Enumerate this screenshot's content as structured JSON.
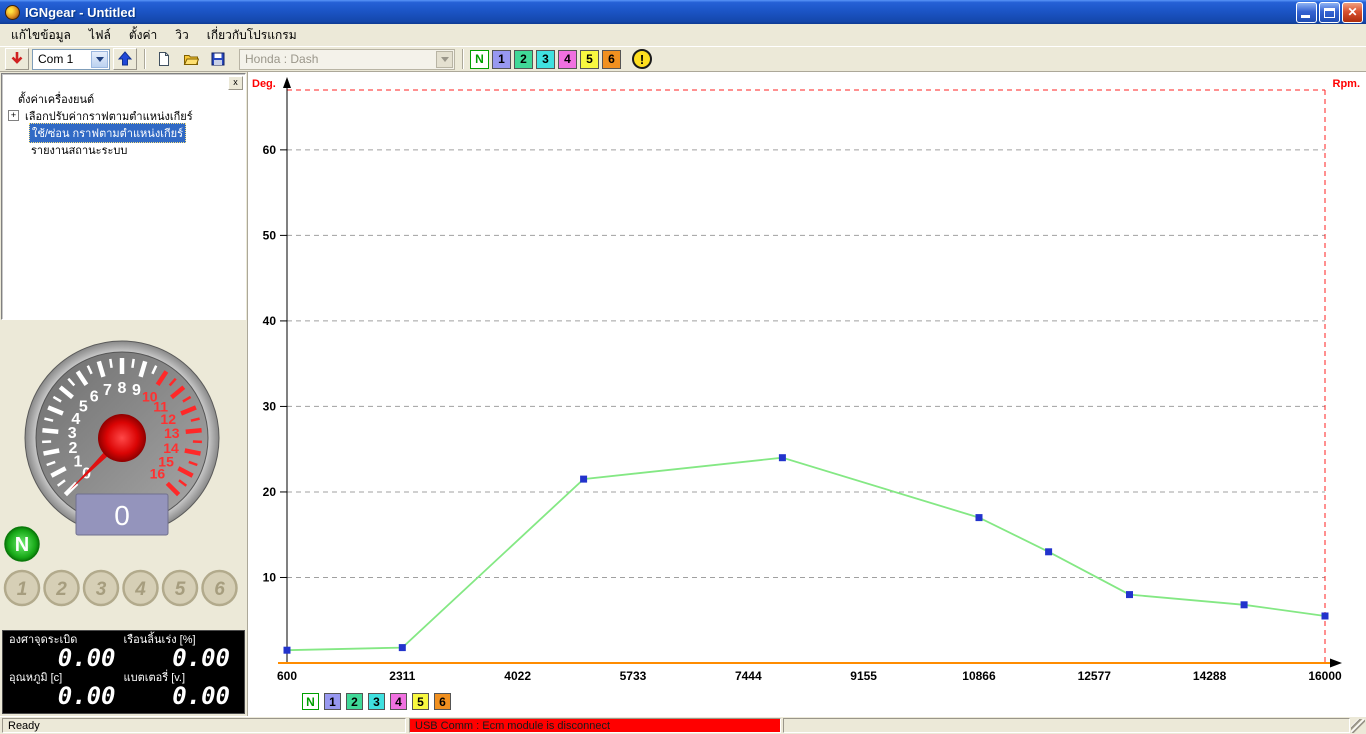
{
  "window": {
    "title": "IGNgear - Untitled"
  },
  "menu": {
    "items": [
      "แก้ไขข้อมูล",
      "ไฟล์",
      "ตั้งค่า",
      "วิว",
      "เกี่ยวกับโปรแกรม"
    ]
  },
  "toolbar": {
    "com_select": {
      "value": "Com 1"
    },
    "model_select": {
      "value": "Honda : Dash"
    },
    "alert_glyph": "!",
    "gears": [
      {
        "label": "N",
        "bg": "#ffffff",
        "fg": "#00a000",
        "bd": "#00a000"
      },
      {
        "label": "1",
        "bg": "#9898f0",
        "fg": "#000000",
        "bd": "#555555"
      },
      {
        "label": "2",
        "bg": "#40d898",
        "fg": "#000000",
        "bd": "#555555"
      },
      {
        "label": "3",
        "bg": "#40e0e0",
        "fg": "#000000",
        "bd": "#555555"
      },
      {
        "label": "4",
        "bg": "#f070e0",
        "fg": "#000000",
        "bd": "#555555"
      },
      {
        "label": "5",
        "bg": "#f8f840",
        "fg": "#000000",
        "bd": "#555555"
      },
      {
        "label": "6",
        "bg": "#f09020",
        "fg": "#000000",
        "bd": "#555555"
      }
    ]
  },
  "sidebar": {
    "items": [
      {
        "label": "ตั้งค่าเครื่องยนต์",
        "selected": false,
        "expander": ""
      },
      {
        "label": "เลือกปรับค่ากราฟตามตำแหน่งเกียร์",
        "selected": false,
        "expander": "+"
      },
      {
        "label": "ใช้/ซ่อน กราฟตามตำแหน่งเกียร์",
        "selected": true,
        "expander": ""
      },
      {
        "label": "รายงานสถานะระบบ",
        "selected": false,
        "expander": ""
      }
    ]
  },
  "gauge": {
    "min": 0,
    "max": 16,
    "redline_from": 10,
    "numbers": [
      0,
      1,
      2,
      3,
      4,
      5,
      6,
      7,
      8,
      9,
      10,
      11,
      12,
      13,
      14,
      15,
      16
    ],
    "value_display": "0",
    "neutral_label": "N",
    "gear_labels": [
      "1",
      "2",
      "3",
      "4",
      "5",
      "6"
    ]
  },
  "readouts": {
    "cells": [
      {
        "label": "องศาจุดระเบิด",
        "value": "0.00"
      },
      {
        "label": "เรือนลิ้นเร่ง [%]",
        "value": "0.00"
      },
      {
        "label": "อุณหภูมิ [c]",
        "value": "0.00"
      },
      {
        "label": "แบตเตอรี่ [v.]",
        "value": "0.00"
      }
    ]
  },
  "chart_data": {
    "type": "line",
    "title": "",
    "xlabel": "Rpm.",
    "ylabel": "Deg.",
    "xlim": [
      600,
      16000
    ],
    "ylim": [
      0,
      67
    ],
    "x_ticks": [
      600,
      2311,
      4022,
      5733,
      7444,
      9155,
      10866,
      12577,
      14288,
      16000
    ],
    "y_ticks": [
      10,
      20,
      30,
      40,
      50,
      60
    ],
    "grid": "horizontal-dashed",
    "legend": [
      "N",
      "1",
      "2",
      "3",
      "4",
      "5",
      "6"
    ],
    "legend_position": "bottom-left",
    "colors": {
      "line": "#84e884",
      "marker": "#2233cc",
      "axis_x": "#ff8c00",
      "boundary": "#ff2020",
      "grid": "#a0a0a0",
      "axis_label": "#ff0000"
    },
    "series": [
      {
        "name": "N",
        "points": [
          [
            600,
            1.5
          ],
          [
            2311,
            1.8
          ],
          [
            5000,
            21.5
          ],
          [
            7950,
            24
          ],
          [
            10866,
            17
          ],
          [
            11900,
            13
          ],
          [
            13100,
            8
          ],
          [
            14800,
            6.8
          ],
          [
            16000,
            5.5
          ]
        ]
      }
    ]
  },
  "statusbar": {
    "ready": "Ready",
    "usb": "USB Comm : Ecm module is disconnect"
  }
}
